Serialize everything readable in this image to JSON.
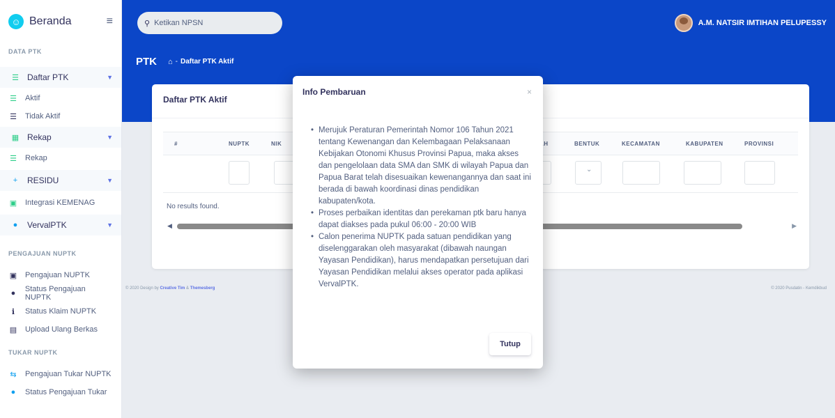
{
  "sidebar": {
    "brand": "Beranda",
    "brand_icon": "user-circle-icon",
    "toggle_icon": "hamburger-icon",
    "sections": {
      "data_ptk": "DATA PTK",
      "pengajuan_nuptk": "PENGAJUAN NUPTK",
      "tukar_nuptk": "TUKAR NUPTK"
    },
    "items": {
      "daftar_ptk": "Daftar PTK",
      "aktif": "Aktif",
      "tidak_aktif": "Tidak Aktif",
      "rekap": "Rekap",
      "rekap_sub": "Rekap",
      "residu": "RESIDU",
      "integrasi": "Integrasi KEMENAG",
      "vervalptk": "VervalPTK",
      "pengajuan_nuptk": "Pengajuan NUPTK",
      "status_pengajuan_nuptk": "Status Pengajuan NUPTK",
      "status_klaim_nuptk": "Status Klaim NUPTK",
      "upload_ulang": "Upload Ulang Berkas",
      "pengajuan_tukar": "Pengajuan Tukar NUPTK",
      "status_pengajuan_tukar": "Status Pengajuan Tukar"
    }
  },
  "header": {
    "search_placeholder": "Ketikan NPSN",
    "user_name": "A.M. NATSIR IMTIHAN PELUPESSY",
    "page_title": "PTK",
    "breadcrumb_sep": "-",
    "breadcrumb_current": "Daftar PTK Aktif"
  },
  "card": {
    "title": "Daftar PTK Aktif",
    "columns": {
      "no": "#",
      "nuptk": "NUPTK",
      "nik": "NIK",
      "ah": "AH",
      "bentuk": "BENTUK",
      "kecamatan": "KECAMATAN",
      "kabupaten": "KABUPATEN",
      "provinsi": "PROVINSI"
    },
    "no_results": "No results found."
  },
  "footer": {
    "prefix": "© 2020 Design by",
    "creative_tim": "Creative Tim",
    "amp": "&",
    "themesberg": "Themesberg",
    "right": "© 2020 Pusdatin - Kemdikbud"
  },
  "modal": {
    "title": "Info Pembaruan",
    "close_symbol": "×",
    "bullets": [
      "Merujuk Peraturan Pemerintah Nomor 106 Tahun 2021 tentang Kewenangan dan Kelembagaan Pelaksanaan Kebijakan Otonomi Khusus Provinsi Papua, maka akses dan pengelolaan data SMA dan SMK di wilayah Papua dan Papua Barat telah disesuaikan kewenangannya dan saat ini berada di bawah koordinasi dinas pendidikan kabupaten/kota.",
      "Proses perbaikan identitas dan perekaman ptk baru hanya dapat diakses pada pukul 06:00 - 20:00 WIB",
      "Calon penerima NUPTK pada satuan pendidikan yang diselenggarakan oleh masyarakat (dibawah naungan Yayasan Pendidikan), harus mendapatkan persetujuan dari Yayasan Pendidikan melalui akses operator pada aplikasi VervalPTK."
    ],
    "button": "Tutup"
  },
  "colors": {
    "header_blue": "#0b46c8",
    "accent": "#5e72e4",
    "green": "#2dce89",
    "cyan": "#11cdef"
  }
}
